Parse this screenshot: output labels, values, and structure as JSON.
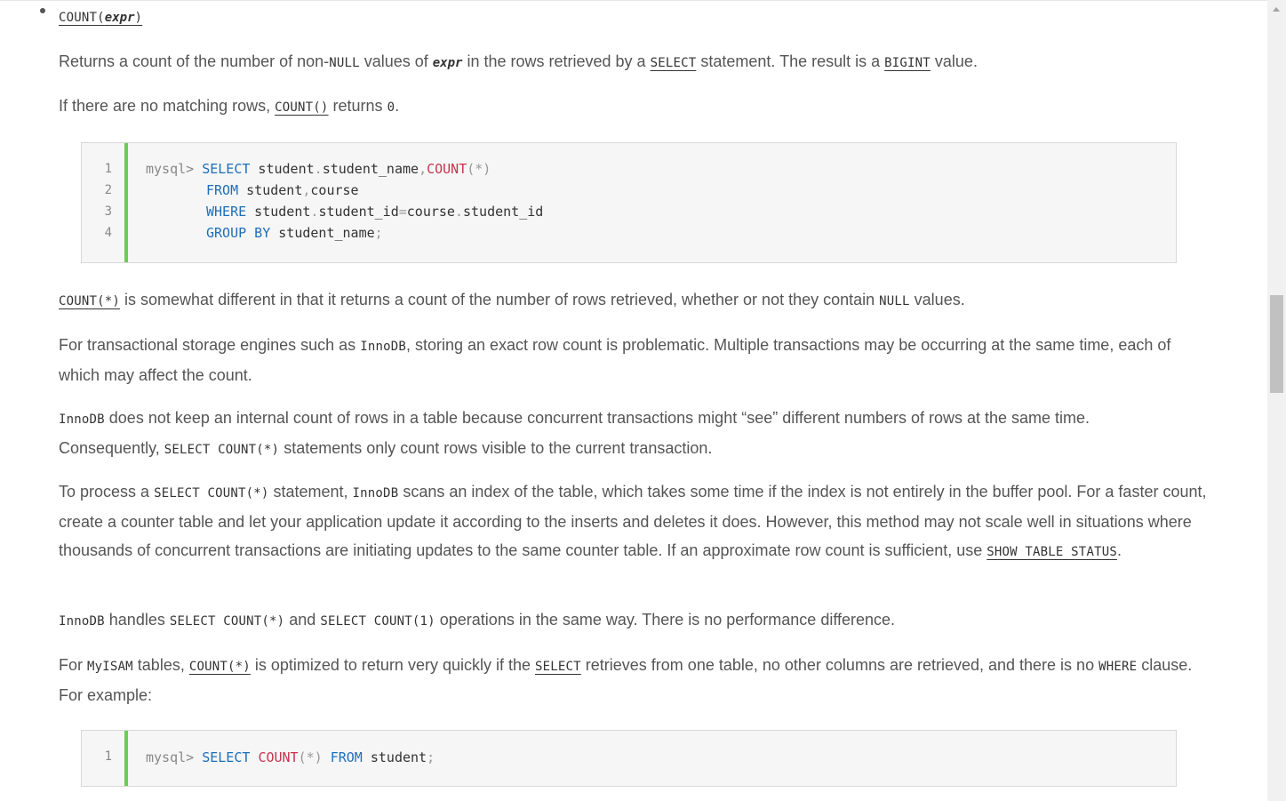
{
  "bullet": {
    "fn": "COUNT(",
    "arg": "expr",
    "close": ")"
  },
  "p1": {
    "t1": "Returns a count of the number of non-",
    "c1": "NULL",
    "t2": " values of ",
    "c2": "expr",
    "t3": " in the rows retrieved by a ",
    "c3": "SELECT",
    "t4": " statement. The result is a ",
    "c4": "BIGINT",
    "t5": " value."
  },
  "p2": {
    "t1": "If there are no matching rows, ",
    "c1": "COUNT()",
    "t2": " returns ",
    "c2": "0",
    "t3": "."
  },
  "code1": {
    "line_numbers": [
      "1",
      "2",
      "3",
      "4"
    ],
    "l1": {
      "prompt": "mysql>",
      "kw1": "SELECT",
      "t1": " student",
      "p1": ".",
      "t2": "student_name",
      "p2": ",",
      "fn": "COUNT",
      "p3": "(*)"
    },
    "l2": {
      "kw1": "FROM",
      "t1": " student",
      "p1": ",",
      "t2": "course"
    },
    "l3": {
      "kw1": "WHERE",
      "t1": " student",
      "p1": ".",
      "t2": "student_id",
      "p2": "=",
      "t3": "course",
      "p3": ".",
      "t4": "student_id"
    },
    "l4": {
      "kw1": "GROUP BY",
      "t1": " student_name",
      "p1": ";"
    }
  },
  "p3": {
    "c1": "COUNT(*)",
    "t1": " is somewhat different in that it returns a count of the number of rows retrieved, whether or not they contain ",
    "c2": "NULL",
    "t2": " values."
  },
  "p4": {
    "t1": "For transactional storage engines such as ",
    "c1": "InnoDB",
    "t2": ", storing an exact row count is problematic. Multiple transactions may be occurring at the same time, each of which may affect the count."
  },
  "p5": {
    "c1": "InnoDB",
    "t1": " does not keep an internal count of rows in a table because concurrent transactions might “see” different numbers of rows at the same time. Consequently, ",
    "c2": "SELECT COUNT(*)",
    "t2": " statements only count rows visible to the current transaction."
  },
  "p6": {
    "t1": "To process a ",
    "c1": "SELECT COUNT(*)",
    "t2": " statement, ",
    "c2": "InnoDB",
    "t3": " scans an index of the table, which takes some time if the index is not entirely in the buffer pool. For a faster count, create a counter table and let your application update it according to the inserts and deletes it does. However, this method may not scale well in situations where thousands of concurrent transactions are initiating updates to the same counter table. If an approximate row count is sufficient, use ",
    "c3": "SHOW TABLE STATUS",
    "t4": "."
  },
  "p7": {
    "c1": "InnoDB",
    "t1": " handles ",
    "c2": "SELECT COUNT(*)",
    "t2": " and ",
    "c3": "SELECT COUNT(1)",
    "t3": " operations in the same way. There is no performance difference."
  },
  "p8": {
    "t1": "For ",
    "c1": "MyISAM",
    "t2": " tables, ",
    "c2": "COUNT(*)",
    "t3": " is optimized to return very quickly if the ",
    "c3": "SELECT",
    "t4": " retrieves from one table, no other columns are retrieved, and there is no ",
    "c4": "WHERE",
    "t5": " clause. For example:"
  },
  "code2": {
    "line_numbers": [
      "1"
    ],
    "l1": {
      "prompt": "mysql>",
      "kw1": "SELECT",
      "fn": "COUNT",
      "p1": "(*)",
      "kw2": "FROM",
      "t1": " student",
      "p2": ";"
    }
  }
}
